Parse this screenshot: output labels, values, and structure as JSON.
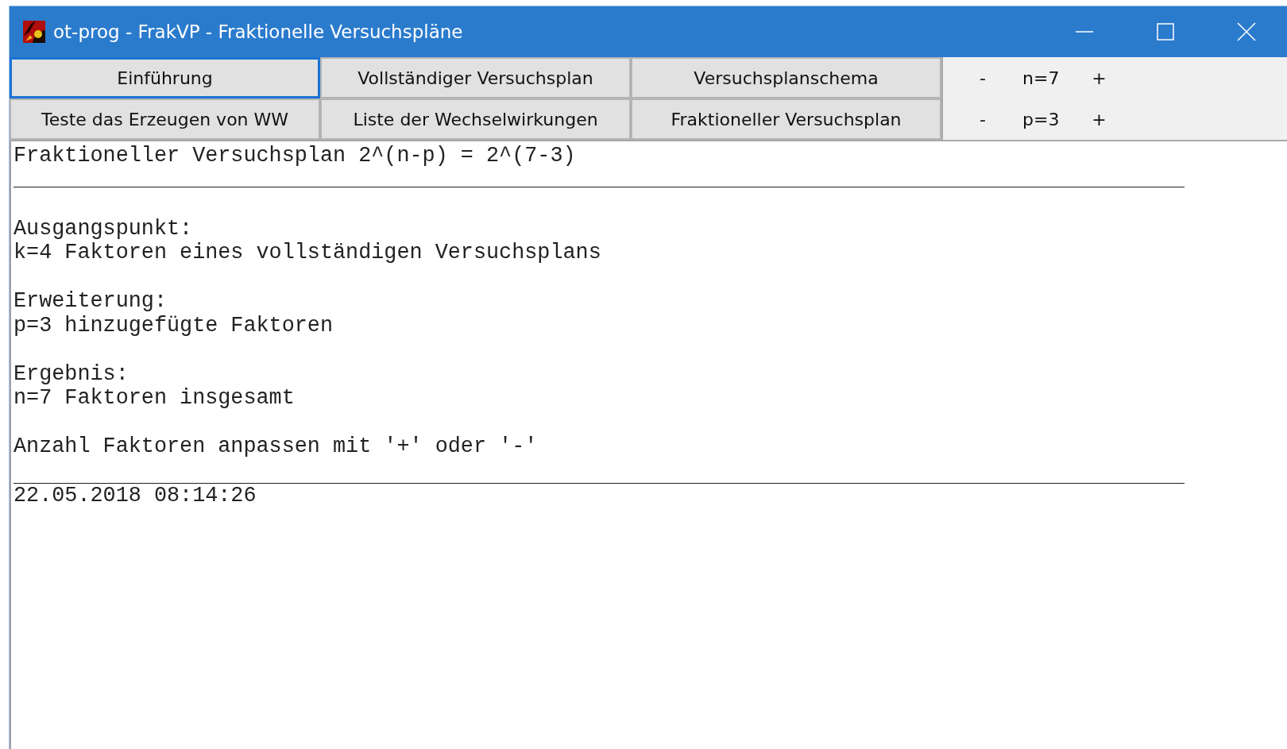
{
  "window": {
    "title": "ot-prog - FrakVP - Fraktionelle Versuchspläne"
  },
  "buttons": [
    {
      "label": "Einführung",
      "selected": true
    },
    {
      "label": "Vollständiger Versuchsplan",
      "selected": false
    },
    {
      "label": "Versuchsplanschema",
      "selected": false
    },
    {
      "label": "Teste das Erzeugen von WW",
      "selected": false
    },
    {
      "label": "Liste der Wechselwirkungen",
      "selected": false
    },
    {
      "label": "Fraktioneller Versuchsplan",
      "selected": false
    }
  ],
  "counters": [
    {
      "minus": "-",
      "value": "n=7",
      "plus": "+"
    },
    {
      "minus": "-",
      "value": "p=3",
      "plus": "+"
    }
  ],
  "output": {
    "heading": "Fraktioneller Versuchsplan 2^(n-p) = 2^(7-3)",
    "sections": [
      {
        "label": "Ausgangspunkt:",
        "text": "k=4 Faktoren eines vollständigen Versuchsplans"
      },
      {
        "label": "Erweiterung:",
        "text": "p=3 hinzugefügte Faktoren"
      },
      {
        "label": "Ergebnis:",
        "text": "n=7 Faktoren insgesamt"
      }
    ],
    "hint": "Anzahl Faktoren anpassen mit '+' oder '-'",
    "timestamp": "22.05.2018 08:14:26"
  }
}
